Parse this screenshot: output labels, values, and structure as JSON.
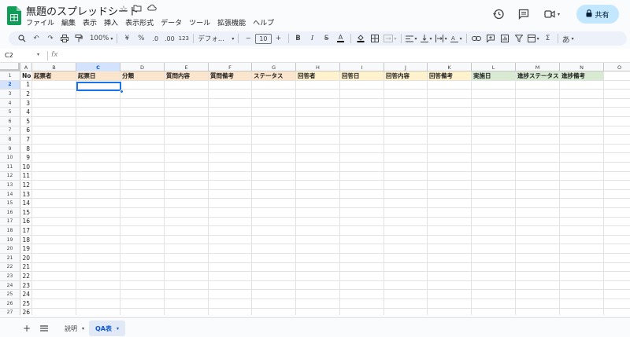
{
  "app": {
    "title": "無題のスプレッドシート"
  },
  "menu": [
    "ファイル",
    "編集",
    "表示",
    "挿入",
    "表示形式",
    "データ",
    "ツール",
    "拡張機能",
    "ヘルプ"
  ],
  "share_label": "共有",
  "toolbar": {
    "zoom": "100%",
    "currency": "¥",
    "percent": "%",
    "dec_decrease": ".0",
    "dec_increase": ".00",
    "format_more": "123",
    "font": "デフォ...",
    "font_size": "10",
    "input_tool": "あ"
  },
  "formula_bar": {
    "name_box": "C2",
    "fx": "fx"
  },
  "columns": [
    "A",
    "B",
    "C",
    "D",
    "E",
    "F",
    "G",
    "H",
    "I",
    "J",
    "K",
    "L",
    "M",
    "N",
    "O"
  ],
  "selected_column": "C",
  "selected_row": "2",
  "header_row": {
    "A": "No",
    "B": "起票者",
    "C": "起票日",
    "D": "分類",
    "E": "質問内容",
    "F": "質問備考",
    "G": "ステータス",
    "H": "回答者",
    "I": "回答日",
    "J": "回答内容",
    "K": "回答備考",
    "L": "実施日",
    "M": "進捗ステータス",
    "N": "進捗備考"
  },
  "header_colors": {
    "orange": "#fce5cd",
    "yellow": "#fff2cc",
    "green": "#d9ead3"
  },
  "row_numbers": [
    "1",
    "2",
    "3",
    "4",
    "5",
    "6",
    "7",
    "8",
    "9",
    "10",
    "11",
    "12",
    "13",
    "14",
    "15",
    "16",
    "17",
    "18",
    "19",
    "20",
    "21",
    "22",
    "23",
    "24",
    "25",
    "26",
    "27"
  ],
  "no_values": [
    "1",
    "2",
    "3",
    "4",
    "5",
    "6",
    "7",
    "8",
    "9",
    "10",
    "11",
    "12",
    "13",
    "14",
    "15",
    "16",
    "17",
    "18",
    "19",
    "20",
    "21",
    "22",
    "23",
    "24",
    "25",
    "26"
  ],
  "sheets": [
    {
      "label": "説明",
      "active": false
    },
    {
      "label": "QA表",
      "active": true
    }
  ]
}
